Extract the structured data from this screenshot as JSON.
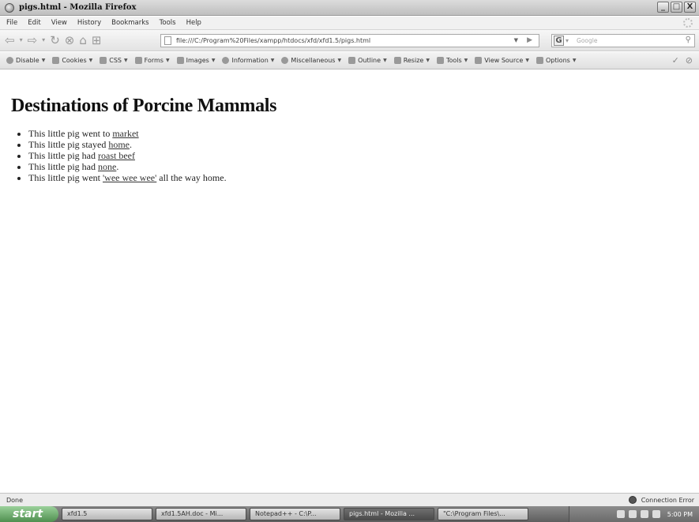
{
  "window": {
    "title": "pigs.html - Mozilla Firefox",
    "min": "_",
    "max": "□",
    "close": "X"
  },
  "menu": {
    "items": [
      "File",
      "Edit",
      "View",
      "History",
      "Bookmarks",
      "Tools",
      "Help"
    ]
  },
  "nav": {
    "url": "file:///C:/Program%20Files/xampp/htdocs/xfd/xfd1.5/pigs.html",
    "search_engine": "G",
    "search_placeholder": "Google"
  },
  "devbar": {
    "items": [
      "Disable",
      "Cookies",
      "CSS",
      "Forms",
      "Images",
      "Information",
      "Miscellaneous",
      "Outline",
      "Resize",
      "Tools",
      "View Source",
      "Options"
    ],
    "checkmark": "✓"
  },
  "page": {
    "heading": "Destinations of Porcine Mammals",
    "items": [
      {
        "before": "This little pig went to ",
        "link": "market",
        "after": ""
      },
      {
        "before": "This little pig stayed ",
        "link": "home",
        "after": "."
      },
      {
        "before": "This little pig had ",
        "link": "roast beef",
        "after": ""
      },
      {
        "before": "This little pig had ",
        "link": "none",
        "after": "."
      },
      {
        "before": "This little pig went ",
        "link": "'wee wee wee'",
        "after": " all the way home."
      }
    ]
  },
  "status": {
    "text": "Done",
    "connection": "Connection Error"
  },
  "taskbar": {
    "start": "start",
    "buttons": [
      "xfd1.5",
      "xfd1.5AH.doc - Mi...",
      "Notepad++ - C:\\P...",
      "pigs.html - Mozilla ...",
      "\"C:\\Program Files\\..."
    ],
    "clock": "5:00 PM"
  }
}
